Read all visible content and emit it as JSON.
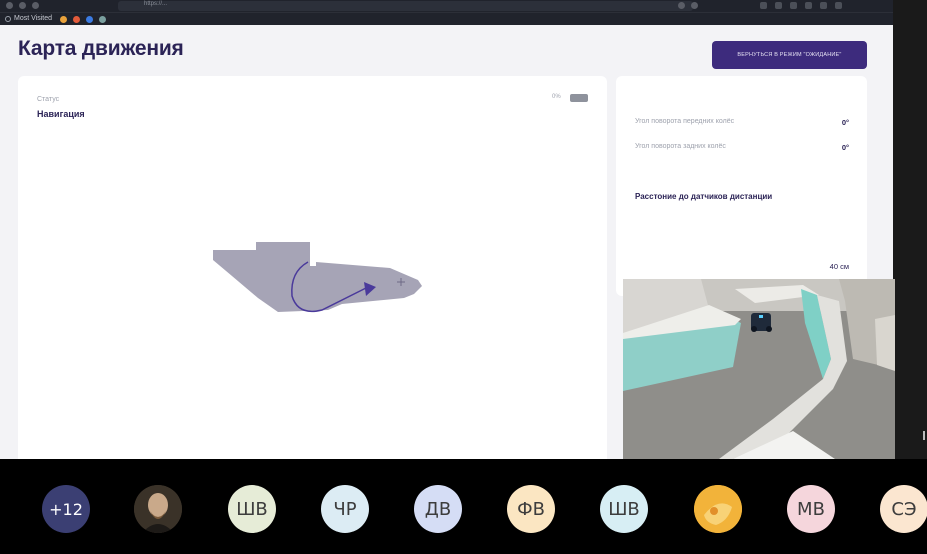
{
  "browser": {
    "url": "https://...",
    "bookmarks_label": "Most Visited"
  },
  "page": {
    "title": "Карта движения",
    "mode_button_label": "ВЕРНУТЬСЯ В РЕЖИМ \"ОЖИДАНИЕ\""
  },
  "status_panel": {
    "status_label": "Статус",
    "status_value": "Навигация",
    "battery_text": "0%"
  },
  "info_panel": {
    "rows": [
      {
        "label": "Угол поворота передних колёс",
        "value": "0°"
      },
      {
        "label": "Угол поворота задних колёс",
        "value": "0°"
      }
    ],
    "distance_title": "Расстоние до датчиков дистанции",
    "distance_value": "40 см"
  },
  "colors": {
    "accent": "#3d2b7d",
    "heading": "#2b2356",
    "map_area": "#a6a4b6",
    "path": "#4a3a9b"
  },
  "participants": {
    "more_count": "+12",
    "items": [
      {
        "initials": "",
        "bg": "#3a3228",
        "fg": "#ffffff",
        "photo": "portrait"
      },
      {
        "initials": "ШВ",
        "bg": "#e6ecd7",
        "fg": "#3d3d3d"
      },
      {
        "initials": "ЧР",
        "bg": "#dcecf4",
        "fg": "#3d3d3d"
      },
      {
        "initials": "ДВ",
        "bg": "#d5ddf5",
        "fg": "#3d3d3d"
      },
      {
        "initials": "ФВ",
        "bg": "#fbe6c2",
        "fg": "#3d3d3d"
      },
      {
        "initials": "ШВ",
        "bg": "#d7eef4",
        "fg": "#3d3d3d"
      },
      {
        "initials": "",
        "bg": "#f5b83b",
        "fg": "#ffffff",
        "photo": "yellow"
      },
      {
        "initials": "МВ",
        "bg": "#f5d6dc",
        "fg": "#3d3d3d"
      },
      {
        "initials": "СЭ",
        "bg": "#fbe6d0",
        "fg": "#3d3d3d"
      }
    ]
  }
}
